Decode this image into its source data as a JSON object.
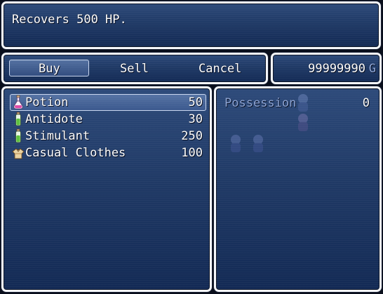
{
  "help": {
    "text": "Recovers 500 HP."
  },
  "commands": [
    {
      "label": "Buy",
      "selected": true
    },
    {
      "label": "Sell",
      "selected": false
    },
    {
      "label": "Cancel",
      "selected": false
    }
  ],
  "gold": {
    "amount": "99999990",
    "unit": "G"
  },
  "shop_items": [
    {
      "name": "Potion",
      "price": "50",
      "icon": "potion-flask-icon",
      "selected": true
    },
    {
      "name": "Antidote",
      "price": "30",
      "icon": "green-bottle-icon",
      "selected": false
    },
    {
      "name": "Stimulant",
      "price": "250",
      "icon": "green-bottle-icon",
      "selected": false
    },
    {
      "name": "Casual Clothes",
      "price": "100",
      "icon": "clothes-icon",
      "selected": false
    }
  ],
  "status": {
    "possession_label": "Possession",
    "possession_value": "0"
  },
  "colors": {
    "window_top": "#2d4a7a",
    "window_bottom": "#132a55",
    "border": "#f4f6fb",
    "text": "#ffffff",
    "system_text": "#8fa7d8",
    "gold_unit": "#8fa7d8"
  }
}
